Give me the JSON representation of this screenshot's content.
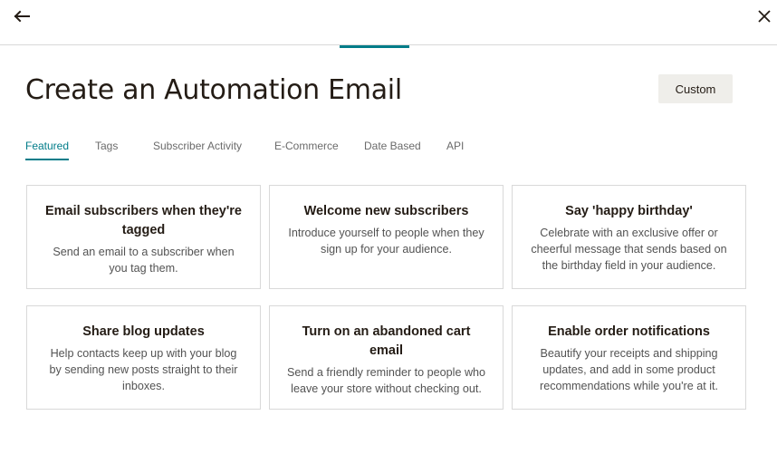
{
  "header": {
    "back_icon": "arrow-left-icon",
    "close_icon": "close-icon",
    "accent_color": "#007c89"
  },
  "page": {
    "title": "Create an Automation Email",
    "custom_button": "Custom"
  },
  "tabs": [
    {
      "label": "Featured",
      "active": true
    },
    {
      "label": "Tags",
      "active": false
    },
    {
      "label": "Subscriber Activity",
      "active": false
    },
    {
      "label": "E-Commerce",
      "active": false
    },
    {
      "label": "Date Based",
      "active": false
    },
    {
      "label": "API",
      "active": false
    }
  ],
  "cards": [
    {
      "title": "Email subscribers when they're tagged",
      "description": "Send an email to a subscriber when you tag them."
    },
    {
      "title": "Welcome new subscribers",
      "description": "Introduce yourself to people when they sign up for your audience."
    },
    {
      "title": "Say 'happy birthday'",
      "description": "Celebrate with an exclusive offer or cheerful message that sends based on the birthday field in your audience."
    },
    {
      "title": "Share blog updates",
      "description": "Help contacts keep up with your blog by sending new posts straight to their inboxes."
    },
    {
      "title": "Turn on an abandoned cart email",
      "description": "Send a friendly reminder to people who leave your store without checking out."
    },
    {
      "title": "Enable order notifications",
      "description": "Beautify your receipts and shipping updates, and add in some product recommendations while you're at it."
    }
  ]
}
